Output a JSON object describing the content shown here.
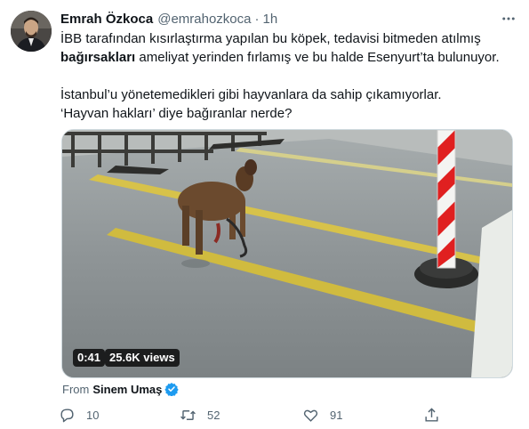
{
  "tweet": {
    "author_name": "Emrah Özkoca",
    "author_handle": "@emrahozkoca",
    "separator": "·",
    "time": "1h",
    "line1": "İBB tarafından kısırlaştırma yapılan bu köpek, tedavisi bitmeden atılmış",
    "line2_bold": "bağırsakları",
    "line2_rest": " ameliyat yerinden fırlamış ve bu halde Esenyurt’ta bulunuyor.",
    "line3": "İstanbul’u yönetemedikleri gibi hayvanlara da sahip çıkamıyorlar.",
    "line4": "‘Hayvan hakları’ diye bağıranlar nerde?"
  },
  "media": {
    "duration": "0:41",
    "views": "25.6K views"
  },
  "attribution": {
    "prefix": "From",
    "source": "Sinem Umaş"
  },
  "actions": {
    "reply_count": "10",
    "retweet_count": "52",
    "like_count": "91"
  },
  "icons": {
    "more": "more-icon",
    "verified": "verified-icon",
    "reply": "reply-icon",
    "retweet": "retweet-icon",
    "like": "like-icon",
    "share": "share-icon"
  },
  "colors": {
    "verified": "#1d9bf0",
    "text_secondary": "#536471",
    "pole_red": "#e02020"
  }
}
